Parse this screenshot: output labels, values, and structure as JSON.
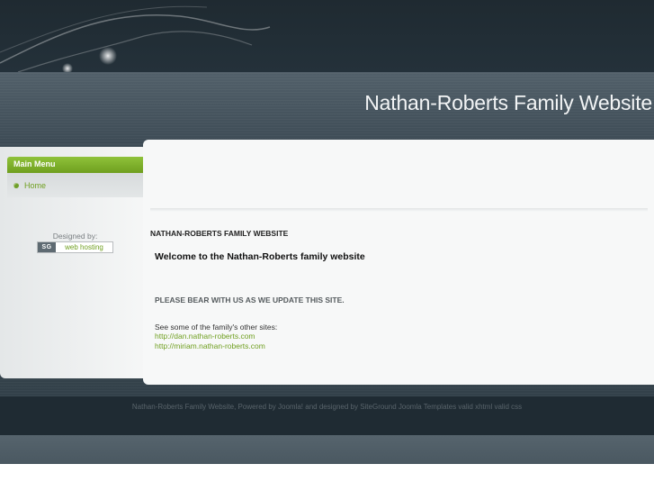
{
  "header": {
    "site_title": "Nathan-Roberts Family Website"
  },
  "sidebar": {
    "menu_title": "Main Menu",
    "items": [
      {
        "label": "Home"
      }
    ],
    "designed_by": "Designed by:",
    "badge_logo": "SG",
    "badge_label": "web hosting"
  },
  "content": {
    "heading": "NATHAN-ROBERTS FAMILY WEBSITE",
    "welcome": "Welcome to the Nathan-Roberts family website",
    "notice": "PLEASE BEAR WITH US AS WE UPDATE THIS SITE.",
    "see_other": "See some of the family's other sites:",
    "links": [
      "http://dan.nathan-roberts.com",
      "http://miriam.nathan-roberts.com"
    ]
  },
  "footer": {
    "text": "Nathan-Roberts Family Website, Powered by Joomla! and designed by SiteGround Joomla Templates valid xhtml valid css"
  },
  "colors": {
    "accent_green": "#6f9f1f",
    "dark_band": "#1f2b33",
    "header_band": "#4a5861"
  }
}
